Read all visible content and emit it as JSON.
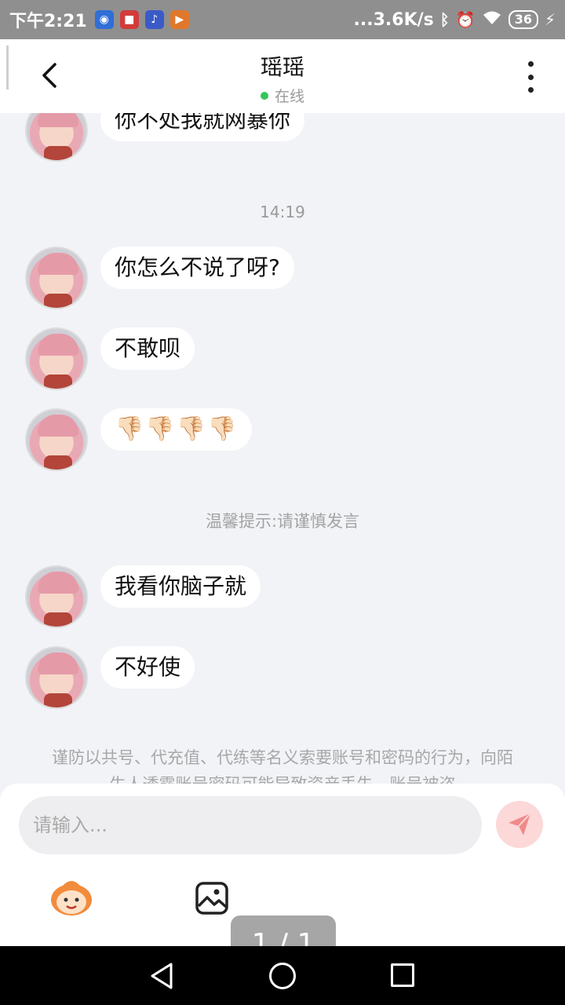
{
  "status_bar": {
    "time": "下午2:21",
    "net_speed": "...3.6K/s",
    "battery": "36",
    "icons": [
      "bluetooth-icon",
      "alarm-icon",
      "wifi-icon",
      "battery-icon",
      "charging-icon"
    ]
  },
  "header": {
    "title": "瑶瑶",
    "status": "在线",
    "status_color": "#33c759"
  },
  "messages": [
    {
      "text": "你不处我就网暴你"
    },
    {
      "text": "你怎么不说了呀?"
    },
    {
      "text": "不敢呗"
    },
    {
      "text": "👎🏻👎🏻👎🏻👎🏻"
    },
    {
      "text": "我看你脑子就"
    },
    {
      "text": "不好使"
    }
  ],
  "timestamps": [
    "14:19"
  ],
  "tip": "温馨提示:请谨慎发言",
  "notice": "谨防以共号、代充值、代练等名义索要账号和密码的行为，向陌生人透露账号密码可能导致资产丢失，账号被盗",
  "input": {
    "placeholder": "请输入..."
  },
  "pager": "1 / 1",
  "colors": {
    "background": "#f2f3f7",
    "bubble": "#ffffff",
    "send_button": "#fcd8d8",
    "send_icon": "#f08a8a"
  }
}
